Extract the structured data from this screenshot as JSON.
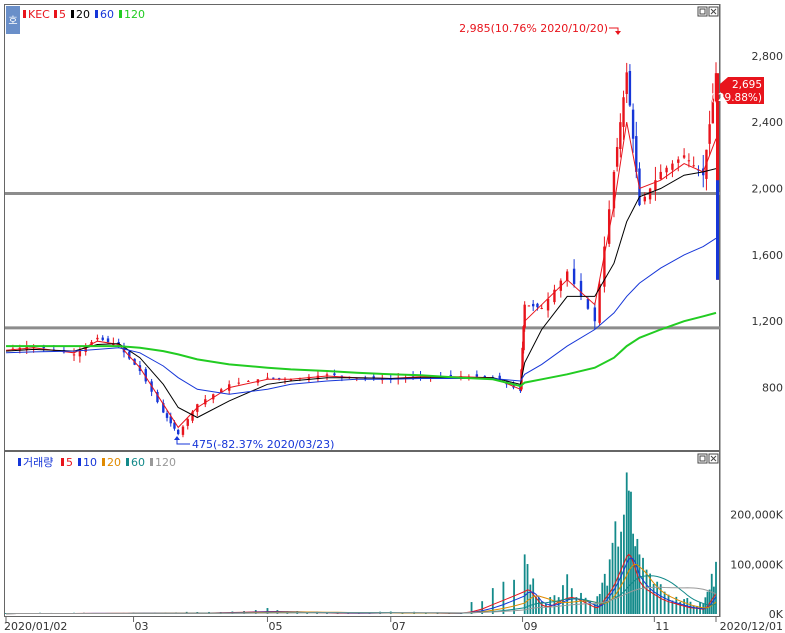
{
  "toolbar": {
    "panel_button": "호"
  },
  "colors": {
    "up": "#e8141c",
    "down": "#1636d8",
    "ma5": "#e8141c",
    "ma20": "#000000",
    "ma60": "#1636d8",
    "ma120": "#22cc22",
    "vma5": "#e8141c",
    "vma10": "#1636d8",
    "vma20": "#e08a00",
    "vma60": "#138a8a",
    "vma120": "#999999",
    "hline": "#8c8c8c",
    "volume_bar": "#138a8a"
  },
  "price_legend": [
    {
      "label": "KEC",
      "color": "#e8141c"
    },
    {
      "label": "5",
      "color": "#e8141c"
    },
    {
      "label": "20",
      "color": "#000000"
    },
    {
      "label": "60",
      "color": "#1636d8"
    },
    {
      "label": "120",
      "color": "#22cc22"
    }
  ],
  "volume_legend": [
    {
      "label": "거래량",
      "color": "#1636d8"
    },
    {
      "label": "5",
      "color": "#e8141c"
    },
    {
      "label": "10",
      "color": "#1636d8"
    },
    {
      "label": "20",
      "color": "#e08a00"
    },
    {
      "label": "60",
      "color": "#138a8a"
    },
    {
      "label": "120",
      "color": "#999999"
    }
  ],
  "annotations": {
    "high": "2,985(10.76% 2020/10/20)",
    "low": "475(-82.37% 2020/03/23)",
    "last_price": "2,695",
    "last_change": "( 29.88%)"
  },
  "chart_data": [
    {
      "type": "candlestick",
      "title": "KEC",
      "ylim": [
        430,
        3100
      ],
      "yticks": [
        800,
        1200,
        1600,
        2000,
        2400,
        2800
      ],
      "ytick_labels": [
        "800",
        "1,200",
        "1,600",
        "2,000",
        "2,400",
        "2,800"
      ],
      "horizontal_lines": [
        1970,
        1160
      ],
      "series": [
        {
          "name": "KEC",
          "x": [
            "2020/01/02",
            "2020/01/15",
            "2020/02/03",
            "2020/02/14",
            "2020/02/24",
            "2020/03/05",
            "2020/03/16",
            "2020/03/23",
            "2020/04/01",
            "2020/04/16",
            "2020/05/04",
            "2020/05/15",
            "2020/06/01",
            "2020/06/15",
            "2020/07/01",
            "2020/07/15",
            "2020/08/03",
            "2020/08/18",
            "2020/08/31",
            "2020/09/02",
            "2020/09/10",
            "2020/09/22",
            "2020/10/05",
            "2020/10/14",
            "2020/10/20",
            "2020/10/26",
            "2020/11/05",
            "2020/11/16",
            "2020/11/25",
            "2020/12/01"
          ],
          "close": [
            1030,
            1050,
            1000,
            1100,
            1050,
            900,
            650,
            520,
            700,
            820,
            860,
            850,
            880,
            860,
            850,
            870,
            870,
            860,
            780,
            1300,
            1280,
            1500,
            1200,
            2100,
            2700,
            1900,
            2100,
            2200,
            2080,
            2695
          ]
        },
        {
          "name": "5",
          "values": [
            1025,
            1040,
            1010,
            1080,
            1060,
            920,
            700,
            560,
            680,
            800,
            850,
            850,
            870,
            860,
            855,
            865,
            865,
            860,
            790,
            1200,
            1300,
            1450,
            1300,
            1900,
            2400,
            2000,
            2050,
            2150,
            2100,
            2300
          ]
        },
        {
          "name": "20",
          "values": [
            1020,
            1030,
            1020,
            1060,
            1065,
            980,
            820,
            680,
            620,
            720,
            820,
            840,
            860,
            860,
            855,
            860,
            860,
            860,
            820,
            950,
            1150,
            1350,
            1350,
            1550,
            1800,
            1950,
            2000,
            2080,
            2100,
            2120
          ]
        },
        {
          "name": "60",
          "values": [
            1010,
            1015,
            1020,
            1030,
            1040,
            1010,
            930,
            860,
            790,
            760,
            790,
            820,
            840,
            850,
            850,
            855,
            855,
            855,
            840,
            880,
            940,
            1050,
            1150,
            1250,
            1350,
            1430,
            1520,
            1600,
            1650,
            1700
          ]
        },
        {
          "name": "120",
          "values": [
            1050,
            1050,
            1050,
            1050,
            1050,
            1040,
            1020,
            1000,
            970,
            940,
            920,
            910,
            900,
            890,
            880,
            875,
            860,
            850,
            810,
            830,
            850,
            880,
            920,
            980,
            1050,
            1100,
            1150,
            1200,
            1230,
            1250
          ]
        }
      ]
    },
    {
      "type": "bar",
      "title": "거래량",
      "ylim": [
        0,
        300000
      ],
      "yticks": [
        0,
        100000,
        200000
      ],
      "ytick_labels": [
        "0K",
        "100,000K",
        "200,000K"
      ],
      "x": [
        "2020/01/02",
        "2020/02/03",
        "2020/03/02",
        "2020/04/01",
        "2020/05/04",
        "2020/06/01",
        "2020/07/01",
        "2020/08/03",
        "2020/09/02",
        "2020/09/10",
        "2020/09/22",
        "2020/10/05",
        "2020/10/12",
        "2020/10/20",
        "2020/10/26",
        "2020/11/05",
        "2020/11/16",
        "2020/11/25",
        "2020/12/01"
      ],
      "values": [
        2000,
        2500,
        3000,
        4000,
        12000,
        3000,
        5000,
        3000,
        120000,
        25000,
        80000,
        20000,
        110000,
        285000,
        120000,
        60000,
        30000,
        20000,
        105000
      ]
    }
  ],
  "xaxis": {
    "tick_labels": [
      "2020/01/02",
      "03",
      "05",
      "07",
      "09",
      "11",
      "2020/12/01"
    ]
  }
}
